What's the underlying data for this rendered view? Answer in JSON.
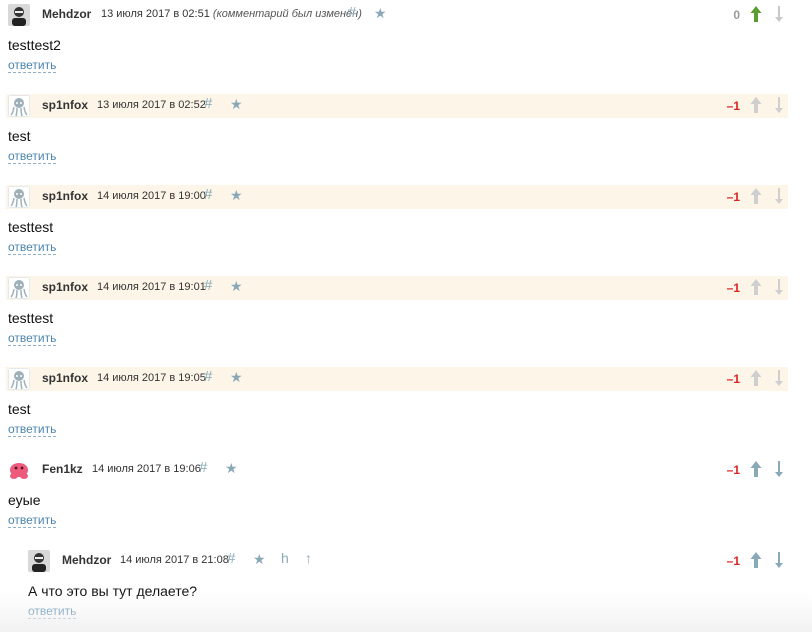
{
  "comments": [
    {
      "username": "Mehdzor",
      "avatar": "bw-face-avatar",
      "date": "13 июля 2017 в 02:51",
      "edited": "(комментарий был изменён)",
      "score": "0",
      "text": "testtest2",
      "reply": "ответить",
      "hash": "#",
      "star": "★"
    },
    {
      "username": "sp1nfox",
      "avatar": "octocat-avatar",
      "date": "13 июля 2017 в 02:52",
      "score": "–1",
      "text": "test",
      "reply": "ответить",
      "hash": "#",
      "star": "★"
    },
    {
      "username": "sp1nfox",
      "avatar": "octocat-avatar",
      "date": "14 июля 2017 в 19:00",
      "score": "–1",
      "text": "testtest",
      "reply": "ответить",
      "hash": "#",
      "star": "★"
    },
    {
      "username": "sp1nfox",
      "avatar": "octocat-avatar",
      "date": "14 июля 2017 в 19:01",
      "score": "–1",
      "text": "testtest",
      "reply": "ответить",
      "hash": "#",
      "star": "★"
    },
    {
      "username": "sp1nfox",
      "avatar": "octocat-avatar",
      "date": "14 июля 2017 в 19:05",
      "score": "–1",
      "text": "test",
      "reply": "ответить",
      "hash": "#",
      "star": "★"
    },
    {
      "username": "Fen1kz",
      "avatar": "pink-blob-avatar",
      "date": "14 июля 2017 в 19:06",
      "score": "–1",
      "text": "еуые",
      "reply": "ответить",
      "hash": "#",
      "star": "★"
    },
    {
      "username": "Mehdzor",
      "avatar": "bw-face-avatar",
      "date": "14 июля 2017 в 21:08",
      "score": "–1",
      "text": "А что это вы тут делаете?",
      "reply": "ответить",
      "hash": "#",
      "star": "★",
      "parent_link": "h",
      "branch_link": "↑"
    }
  ],
  "colors": {
    "owner_highlight": "#fdf5e8",
    "negative_score": "#dd2222",
    "upvoted_green": "#5a9e2f",
    "link_blue": "#4b84ae",
    "icon_gray_blue": "#8aa9b8"
  }
}
